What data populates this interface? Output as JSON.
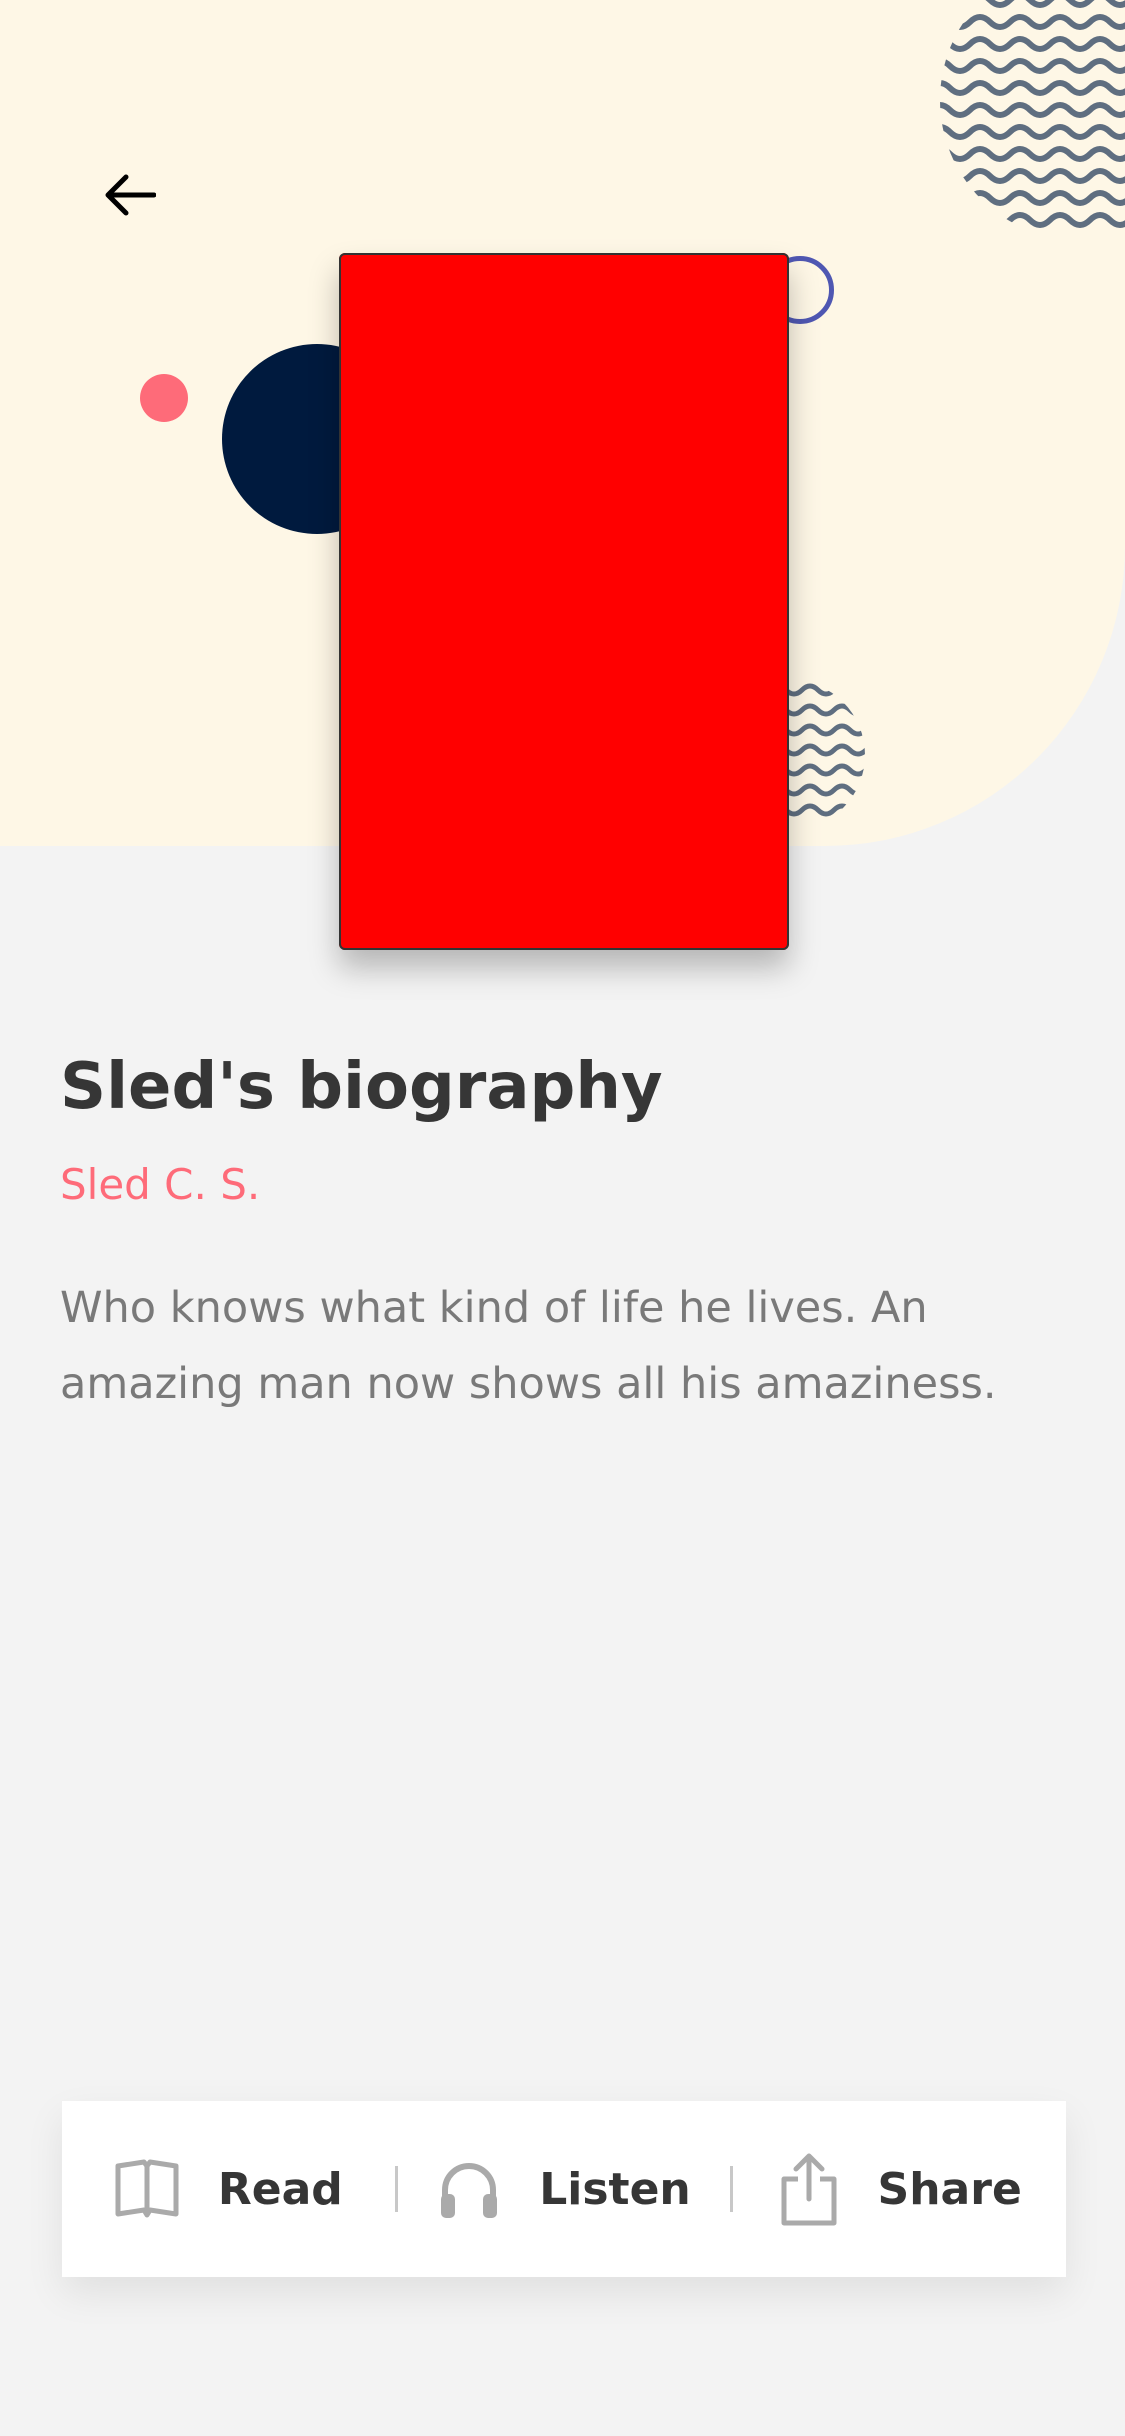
{
  "header": {
    "back_icon": "arrow-left-icon"
  },
  "book": {
    "title": "Sled's biography",
    "author": "Sled C. S.",
    "description": "Who knows what kind of life he lives. An amazing man now shows all his amaziness.",
    "cover_color": "#ff0000"
  },
  "colors": {
    "hero_bg": "#fef7e6",
    "page_bg": "#f3f3f3",
    "accent_pink": "#fe6b79",
    "navy": "#001a3e",
    "ring": "#4f57b2",
    "wave": "#5f6e80",
    "text_dark": "#363636",
    "text_muted": "#797979"
  },
  "actions": [
    {
      "label": "Read",
      "icon": "book-icon"
    },
    {
      "label": "Listen",
      "icon": "headphones-icon"
    },
    {
      "label": "Share",
      "icon": "share-icon"
    }
  ]
}
